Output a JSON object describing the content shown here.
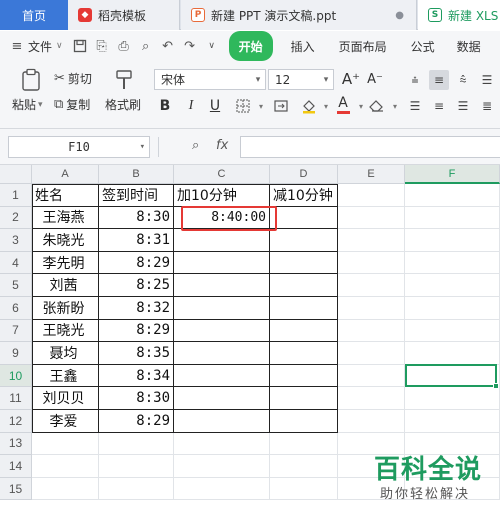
{
  "tabs": {
    "home": "首页",
    "docer": "稻壳模板",
    "ppt": "新建 PPT 演示文稿.ppt",
    "xls": "新建 XLS"
  },
  "menu": {
    "file": "文件",
    "start": "开始",
    "insert": "插入",
    "page_layout": "页面布局",
    "formula": "公式",
    "data": "数据"
  },
  "ribbon": {
    "paste": "粘贴",
    "cut": "剪切",
    "copy": "复制",
    "format_painter": "格式刷",
    "font_name": "宋体",
    "font_size": "12",
    "bold": "B",
    "italic": "I",
    "underline": "U",
    "font_color_letter": "A",
    "grow_font": "A⁺",
    "shrink_font": "A⁻"
  },
  "formula_bar": {
    "name_box": "F10",
    "fx": "fx",
    "content": ""
  },
  "columns": [
    "A",
    "B",
    "C",
    "D",
    "E",
    "F"
  ],
  "active_column": "F",
  "active_row": "10",
  "rows": [
    {
      "num": "1",
      "a": "姓名",
      "b": "签到时间",
      "c": "加10分钟",
      "d": "减10分钟"
    },
    {
      "num": "2",
      "a": "王海燕",
      "b": "8:30",
      "c": "8:40:00",
      "d": ""
    },
    {
      "num": "3",
      "a": "朱晓光",
      "b": "8:31",
      "c": "",
      "d": ""
    },
    {
      "num": "4",
      "a": "李先明",
      "b": "8:29",
      "c": "",
      "d": ""
    },
    {
      "num": "5",
      "a": "刘茜",
      "b": "8:25",
      "c": "",
      "d": ""
    },
    {
      "num": "6",
      "a": "张新盼",
      "b": "8:32",
      "c": "",
      "d": ""
    },
    {
      "num": "7",
      "a": "王晓光",
      "b": "8:29",
      "c": "",
      "d": ""
    },
    {
      "num": "9",
      "a": "聂均",
      "b": "8:35",
      "c": "",
      "d": ""
    },
    {
      "num": "10",
      "a": "王鑫",
      "b": "8:34",
      "c": "",
      "d": ""
    },
    {
      "num": "11",
      "a": "刘贝贝",
      "b": "8:30",
      "c": "",
      "d": ""
    },
    {
      "num": "12",
      "a": "李爱",
      "b": "8:29",
      "c": "",
      "d": ""
    },
    {
      "num": "13",
      "a": "",
      "b": "",
      "c": "",
      "d": ""
    },
    {
      "num": "14",
      "a": "",
      "b": "",
      "c": "",
      "d": ""
    },
    {
      "num": "15",
      "a": "",
      "b": "",
      "c": "",
      "d": ""
    }
  ],
  "watermark": {
    "title": "百科全说",
    "subtitle": "助你轻松解决"
  },
  "colors": {
    "accent_green": "#1e9b5f",
    "start_button": "#2fb85c",
    "highlight_red": "#e53935",
    "home_tab": "#3b78d8"
  }
}
